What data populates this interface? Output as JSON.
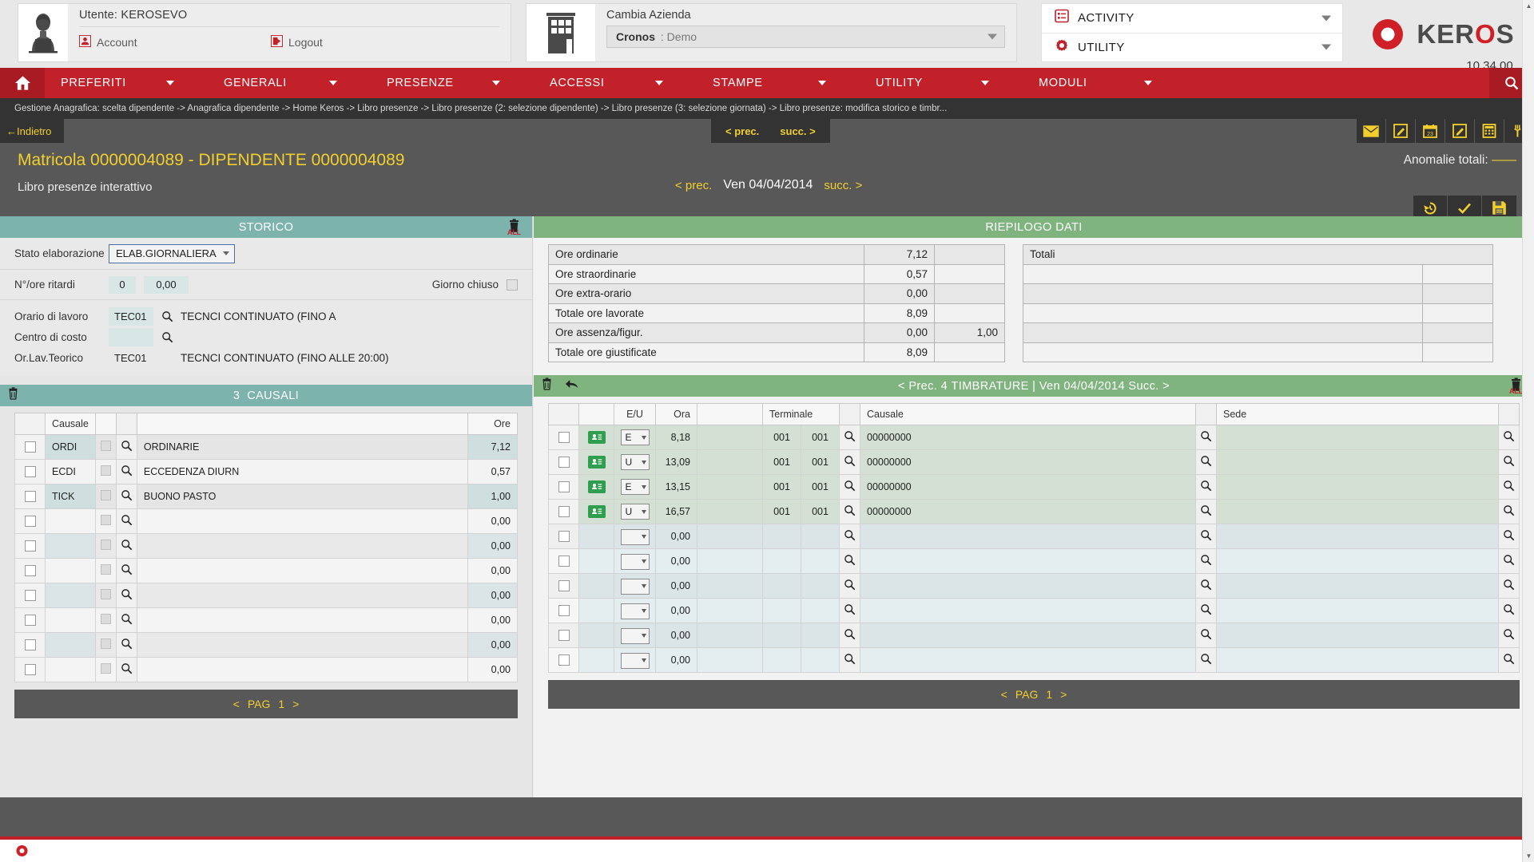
{
  "topbar": {
    "user": {
      "label": "Utente: KEROSEVO",
      "account_link": "Account",
      "logout_link": "Logout"
    },
    "company": {
      "label": "Cambia Azienda",
      "selected_name": "Cronos",
      "selected_sep": " : ",
      "selected_value": "Demo"
    },
    "menus": [
      {
        "label": "ACTIVITY",
        "icon": "list-box-icon"
      },
      {
        "label": "UTILITY",
        "icon": "gear-icon"
      }
    ],
    "logo": {
      "text_a": "KER",
      "text_o": "O",
      "text_b": "S",
      "version": "10.34.00"
    }
  },
  "nav": {
    "items": [
      {
        "label": "PREFERITI"
      },
      {
        "label": "GENERALI"
      },
      {
        "label": "PRESENZE"
      },
      {
        "label": "ACCESSI"
      },
      {
        "label": "STAMPE"
      },
      {
        "label": "UTILITY"
      },
      {
        "label": "MODULI"
      }
    ]
  },
  "breadcrumb": {
    "text": "Gestione Anagrafica: scelta dipendente -> Anagrafica dipendente -> Home Keros -> Libro presenze -> Libro presenze (2: selezione dipendente) -> Libro presenze (3: selezione giornata) -> Libro presenze: modifica storico e timbr..."
  },
  "subheader": {
    "back_label": "←Indietro",
    "prev_label": "< prec.",
    "next_label": "succ. >",
    "title": "Matricola 0000004089 - DIPENDENTE 0000004089",
    "subtitle": "Libro presenze interattivo",
    "anomalie_label": "Anomalie totali:",
    "anomalie_value": "——",
    "day_prev": "< prec.",
    "day_date": "Ven 04/04/2014",
    "day_next": "succ. >",
    "toolbar_icons": [
      "mail-icon",
      "edit-note-icon",
      "calendar-icon",
      "edit-square-icon",
      "calculator-icon",
      "meal-icon"
    ],
    "action_icons": [
      "undo-history-icon",
      "confirm-check-icon",
      "save-disk-icon"
    ]
  },
  "storico": {
    "title": "STORICO",
    "delete_all_icon": "trash-all-icon",
    "stato_label": "Stato elaborazione",
    "stato_value": "ELAB.GIORNALIERA",
    "ritardi_label": "N°/ore ritardi",
    "ritardi_count": "0",
    "ritardi_hours": "0,00",
    "giorno_chiuso_label": "Giorno chiuso",
    "fields": [
      {
        "label": "Orario di lavoro",
        "code": "TEC01",
        "desc": "TECNCI CONTINUATO (FINO A",
        "has_search": true
      },
      {
        "label": "Centro di costo",
        "code": "",
        "desc": "",
        "has_search": true
      },
      {
        "label": "Or.Lav.Teorico",
        "code": "TEC01",
        "desc": "TECNCI CONTINUATO (FINO ALLE 20:00)",
        "has_search": false
      }
    ]
  },
  "riepilogo": {
    "title": "RIEPILOGO DATI",
    "rows": [
      {
        "label": "Ore ordinarie",
        "v1": "7,12",
        "v2": ""
      },
      {
        "label": "Ore straordinarie",
        "v1": "0,57",
        "v2": ""
      },
      {
        "label": "Ore extra-orario",
        "v1": "0,00",
        "v2": ""
      },
      {
        "label": "Totale ore lavorate",
        "v1": "8,09",
        "v2": ""
      },
      {
        "label": "Ore assenza/figur.",
        "v1": "0,00",
        "v2": "1,00"
      },
      {
        "label": "Totale ore giustificate",
        "v1": "8,09",
        "v2": ""
      }
    ],
    "totali_header": "Totali",
    "totali_rows": [
      {
        "main": "",
        "side": ""
      },
      {
        "main": "",
        "side": ""
      },
      {
        "main": "",
        "side": ""
      },
      {
        "main": "",
        "side": ""
      },
      {
        "main": "",
        "side": ""
      }
    ]
  },
  "causali": {
    "count": "3",
    "title": "CAUSALI",
    "trash_icon": "trash-icon",
    "columns": {
      "causale": "Causale",
      "ore": "Ore"
    },
    "rows": [
      {
        "code": "ORDI",
        "desc": "ORDINARIE",
        "ore": "7,12",
        "filled": true
      },
      {
        "code": "ECDI",
        "desc": "ECCEDENZA DIURN",
        "ore": "0,57",
        "filled": true
      },
      {
        "code": "TICK",
        "desc": "BUONO PASTO",
        "ore": "1,00",
        "filled": true
      },
      {
        "code": "",
        "desc": "",
        "ore": "0,00",
        "filled": false
      },
      {
        "code": "",
        "desc": "",
        "ore": "0,00",
        "filled": false
      },
      {
        "code": "",
        "desc": "",
        "ore": "0,00",
        "filled": false
      },
      {
        "code": "",
        "desc": "",
        "ore": "0,00",
        "filled": false
      },
      {
        "code": "",
        "desc": "",
        "ore": "0,00",
        "filled": false
      },
      {
        "code": "",
        "desc": "",
        "ore": "0,00",
        "filled": false
      },
      {
        "code": "",
        "desc": "",
        "ore": "0,00",
        "filled": false
      }
    ],
    "pager": {
      "prev": "<",
      "label": "PAG",
      "page": "1",
      "next": ">"
    }
  },
  "timbrature": {
    "prev_label": "< Prec.",
    "count": "4",
    "title": "TIMBRATURE",
    "separator": "|",
    "date": "Ven 04/04/2014",
    "next_label": "Succ. >",
    "trash_icon": "trash-icon",
    "undo_icon": "undo-arrow-icon",
    "delete_all_icon": "trash-all-icon",
    "columns": {
      "eu": "E/U",
      "ora": "Ora",
      "terminale": "Terminale",
      "causale": "Causale",
      "sede": "Sede"
    },
    "rows": [
      {
        "badge": true,
        "eu": "E",
        "ora": "8,18",
        "term1": "001",
        "term2": "001",
        "causale": "00000000",
        "sede": "",
        "filled": true
      },
      {
        "badge": true,
        "eu": "U",
        "ora": "13,09",
        "term1": "001",
        "term2": "001",
        "causale": "00000000",
        "sede": "",
        "filled": true
      },
      {
        "badge": true,
        "eu": "E",
        "ora": "13,15",
        "term1": "001",
        "term2": "001",
        "causale": "00000000",
        "sede": "",
        "filled": true
      },
      {
        "badge": true,
        "eu": "U",
        "ora": "16,57",
        "term1": "001",
        "term2": "001",
        "causale": "00000000",
        "sede": "",
        "filled": true
      },
      {
        "badge": false,
        "eu": "",
        "ora": "0,00",
        "term1": "",
        "term2": "",
        "causale": "",
        "sede": "",
        "filled": false
      },
      {
        "badge": false,
        "eu": "",
        "ora": "0,00",
        "term1": "",
        "term2": "",
        "causale": "",
        "sede": "",
        "filled": false
      },
      {
        "badge": false,
        "eu": "",
        "ora": "0,00",
        "term1": "",
        "term2": "",
        "causale": "",
        "sede": "",
        "filled": false
      },
      {
        "badge": false,
        "eu": "",
        "ora": "0,00",
        "term1": "",
        "term2": "",
        "causale": "",
        "sede": "",
        "filled": false
      },
      {
        "badge": false,
        "eu": "",
        "ora": "0,00",
        "term1": "",
        "term2": "",
        "causale": "",
        "sede": "",
        "filled": false
      },
      {
        "badge": false,
        "eu": "",
        "ora": "0,00",
        "term1": "",
        "term2": "",
        "causale": "",
        "sede": "",
        "filled": false
      }
    ],
    "pager": {
      "prev": "<",
      "label": "PAG",
      "page": "1",
      "next": ">"
    }
  },
  "colors": {
    "brand_red": "#c2212a",
    "accent_yellow": "#f2cf2d",
    "teal_header": "#7cb3ad",
    "green_header": "#7fb47f",
    "dark_gray": "#585858"
  }
}
